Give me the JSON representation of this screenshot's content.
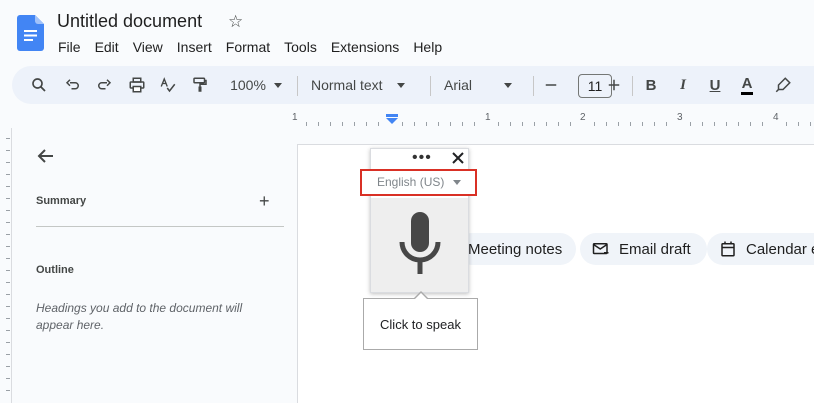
{
  "document": {
    "title": "Untitled document"
  },
  "menu": [
    "File",
    "Edit",
    "View",
    "Insert",
    "Format",
    "Tools",
    "Extensions",
    "Help"
  ],
  "toolbar": {
    "zoom": "100%",
    "style": "Normal text",
    "font": "Arial",
    "font_size": "11",
    "bold": "B",
    "italic": "I",
    "underline": "U",
    "text_color": "A"
  },
  "ruler": {
    "numbers": [
      "1",
      "1",
      "2",
      "3",
      "4"
    ]
  },
  "outline_panel": {
    "summary_label": "Summary",
    "summary_add": "+",
    "outline_label": "Outline",
    "hint": "Headings you add to the document will appear here."
  },
  "chips": [
    {
      "label": "Meeting notes",
      "icon": "meeting-notes-icon"
    },
    {
      "label": "Email draft",
      "icon": "email-draft-icon"
    },
    {
      "label": "Calendar e",
      "icon": "calendar-event-icon"
    }
  ],
  "voice_typing": {
    "language": "English (US)",
    "menu_dots": "•••",
    "tooltip": "Click to speak"
  },
  "colors": {
    "toolbar_bg": "#edf2fa",
    "chip_bg": "#f0f4f9",
    "highlight_border": "#d93025",
    "docs_blue": "#4285f4"
  }
}
